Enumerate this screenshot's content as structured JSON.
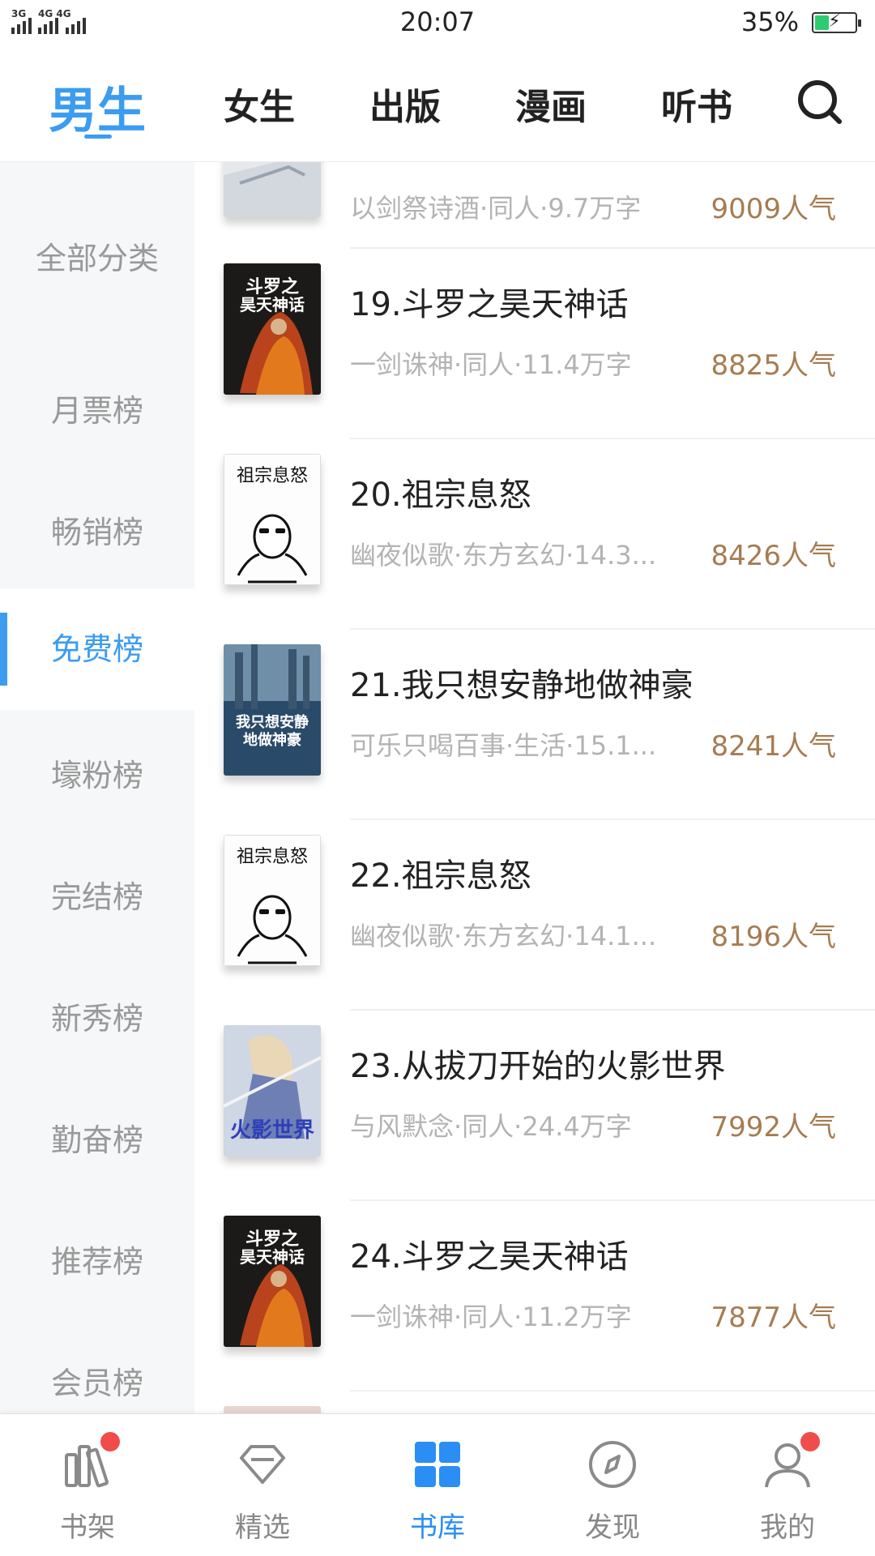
{
  "status_bar": {
    "time": "20:07",
    "battery_percent": "35%",
    "battery_level": 0.35,
    "signal_1_label": "3G",
    "signal_2_label": "4G 4G"
  },
  "top_nav": {
    "tabs": [
      {
        "label": "男生",
        "active": true
      },
      {
        "label": "女生",
        "active": false
      },
      {
        "label": "出版",
        "active": false
      },
      {
        "label": "漫画",
        "active": false
      },
      {
        "label": "听书",
        "active": false
      }
    ],
    "search_icon": "search-icon",
    "accent_color": "#3b9cf0"
  },
  "sidebar": {
    "items": [
      {
        "label": "全部分类",
        "active": false
      },
      {
        "label": "月票榜",
        "active": false
      },
      {
        "label": "畅销榜",
        "active": false
      },
      {
        "label": "免费榜",
        "active": true
      },
      {
        "label": "壕粉榜",
        "active": false
      },
      {
        "label": "完结榜",
        "active": false
      },
      {
        "label": "新秀榜",
        "active": false
      },
      {
        "label": "勤奋榜",
        "active": false
      },
      {
        "label": "推荐榜",
        "active": false
      },
      {
        "label": "会员榜",
        "active": false
      }
    ]
  },
  "book_list": {
    "partial_top": {
      "meta": "以剑祭诗酒·同人·9.7万字",
      "popularity": "9009人气"
    },
    "books": [
      {
        "title": "19.斗罗之昊天神话",
        "meta": "一剑诛神·同人·11.4万字",
        "popularity": "8825人气",
        "cover_text": "斗罗之昊天神话"
      },
      {
        "title": "20.祖宗息怒",
        "meta": "幽夜似歌·东方玄幻·14.3...",
        "popularity": "8426人气",
        "cover_text": "祖宗息怒"
      },
      {
        "title": "21.我只想安静地做神豪",
        "meta": "可乐只喝百事·生活·15.1...",
        "popularity": "8241人气",
        "cover_text": "我只想安静地做神豪"
      },
      {
        "title": "22.祖宗息怒",
        "meta": "幽夜似歌·东方玄幻·14.1...",
        "popularity": "8196人气",
        "cover_text": "祖宗息怒"
      },
      {
        "title": "23.从拔刀开始的火影世界",
        "meta": "与风默念·同人·24.4万字",
        "popularity": "7992人气",
        "cover_text": "火影世界"
      },
      {
        "title": "24.斗罗之昊天神话",
        "meta": "一剑诛神·同人·11.2万字",
        "popularity": "7877人气",
        "cover_text": "斗罗之昊天神话"
      }
    ],
    "popularity_color": "#a67c52"
  },
  "bottom_nav": {
    "items": [
      {
        "label": "书架",
        "icon": "bookshelf-icon",
        "active": false,
        "badge": true
      },
      {
        "label": "精选",
        "icon": "diamond-icon",
        "active": false,
        "badge": false
      },
      {
        "label": "书库",
        "icon": "grid-icon",
        "active": true,
        "badge": false
      },
      {
        "label": "发现",
        "icon": "compass-icon",
        "active": false,
        "badge": false
      },
      {
        "label": "我的",
        "icon": "user-icon",
        "active": false,
        "badge": true
      }
    ]
  }
}
